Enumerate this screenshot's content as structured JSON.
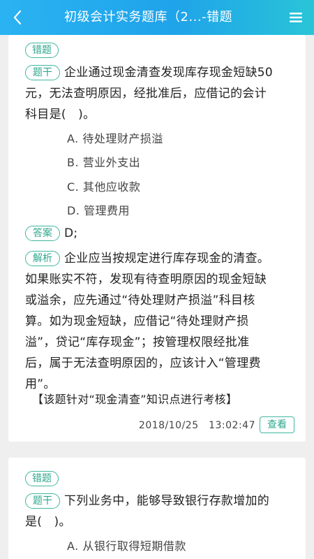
{
  "header": {
    "title": "初级会计实务题库（2...-错题",
    "back_icon": "chevron-left-icon",
    "menu_icon": "hamburger-menu-icon"
  },
  "colors": {
    "header": "#1fa3ea",
    "accent": "#2ea78f"
  },
  "questions": [
    {
      "tag": "错题",
      "stem_label": "题干",
      "stem_lines": [
        "企业通过现金清查发现库存现金短缺50",
        "元，无法查明原因，经批准后，应借记的会计",
        "科目是(　)。"
      ],
      "options": [
        "A. 待处理财产损溢",
        "B. 营业外支出",
        "C. 其他应收款",
        "D. 管理费用"
      ],
      "answer_label": "答案",
      "answer": "D;",
      "analysis_label": "解析",
      "analysis_lines": [
        "企业应当按规定进行库存现金的清查。",
        "如果账实不符，发现有待查明原因的现金短缺",
        "或溢余，应先通过“待处理财产损溢”科目核",
        "算。如为现金短缺，应借记“待处理财产损",
        "溢”，贷记“库存现金”；按管理权限经批准",
        "后，属于无法查明原因的，应该计入“管理费",
        "用”。"
      ],
      "knowledge": "【该题针对“现金清查”知识点进行考核】",
      "timestamp": "2018/10/25　13:02:47",
      "view_label": "查看"
    },
    {
      "tag": "错题",
      "stem_label": "题干",
      "stem_lines": [
        "下列业务中，能够导致银行存款增加的",
        "是(　)。"
      ],
      "options": [
        "A. 从银行取得短期借款"
      ]
    }
  ]
}
